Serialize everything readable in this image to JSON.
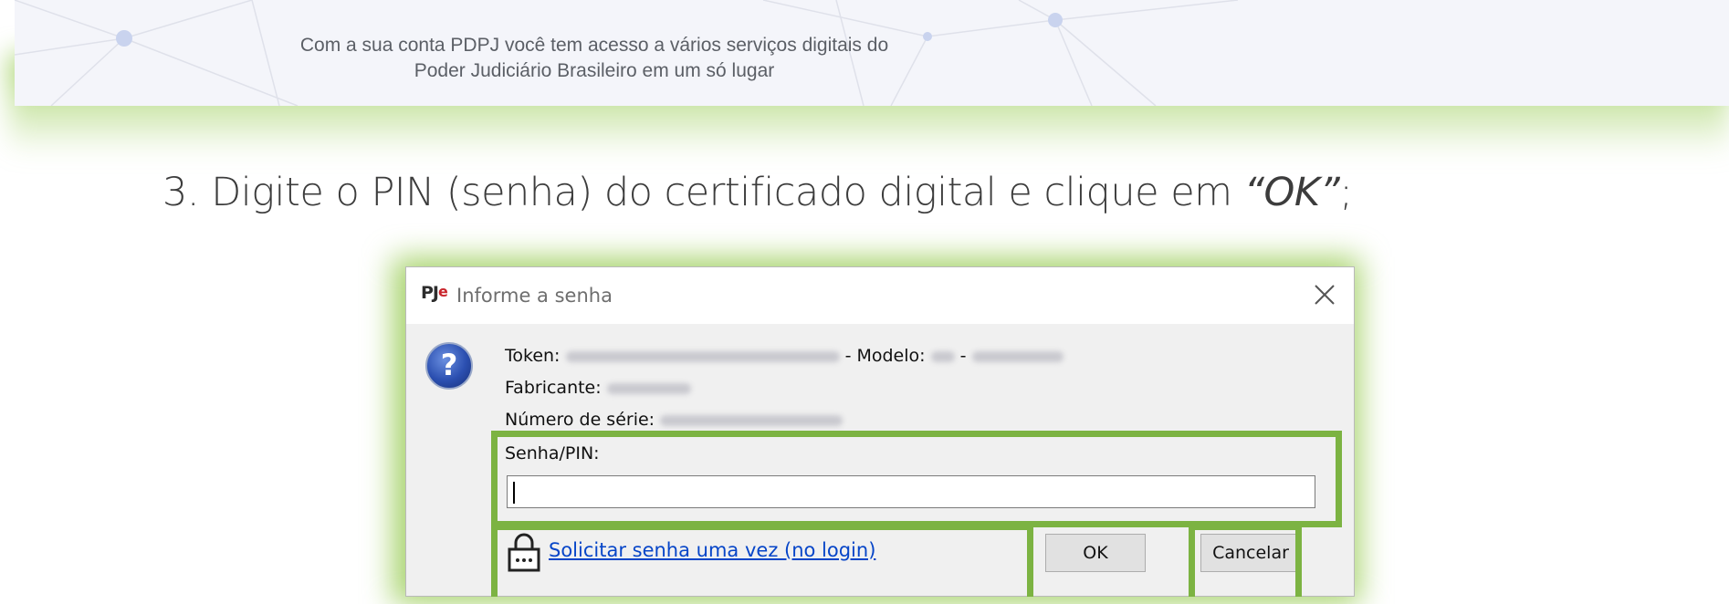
{
  "banner": {
    "line1": "Com a sua conta PDPJ você tem acesso a vários serviços digitais do",
    "line2": "Poder Judiciário Brasileiro em um só lugar"
  },
  "step": {
    "text": "3. Digite o PIN (senha) do certificado digital e clique em ",
    "quoted": "“OK”",
    "end": ";"
  },
  "dialog": {
    "logo_main": "PJ",
    "logo_accent": "e",
    "title": "Informe a senha",
    "icon_glyph": "?",
    "token_label": "Token:",
    "modelo_label": "- Modelo:",
    "dash": "-",
    "fabricante_label": "Fabricante:",
    "serie_label": "Número de série:",
    "pin_label": "Senha/PIN:",
    "once_link": "Solicitar senha uma vez (no login)",
    "ok_label": "OK",
    "cancel_label": "Cancelar"
  },
  "colors": {
    "highlight": "#7cb342",
    "link": "#0645c8"
  }
}
